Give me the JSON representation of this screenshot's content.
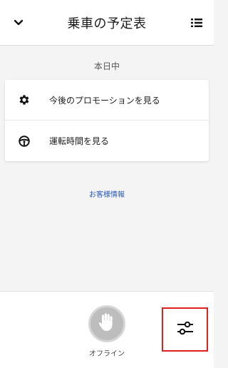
{
  "header": {
    "title": "乗車の予定表",
    "back_icon": "chevron-down-icon",
    "menu_icon": "list-icon"
  },
  "section": {
    "label": "本日中"
  },
  "card": {
    "items": [
      {
        "label": "今後のプロモーションを見る",
        "icon": "gear-icon"
      },
      {
        "label": "運転時間を見る",
        "icon": "steering-wheel-icon"
      }
    ]
  },
  "links": {
    "support": "お客様情報"
  },
  "bottom": {
    "offline_label": "オフライン",
    "offline_icon": "hand-icon",
    "filter_icon": "sliders-icon",
    "highlight_color": "#e01f1f"
  }
}
